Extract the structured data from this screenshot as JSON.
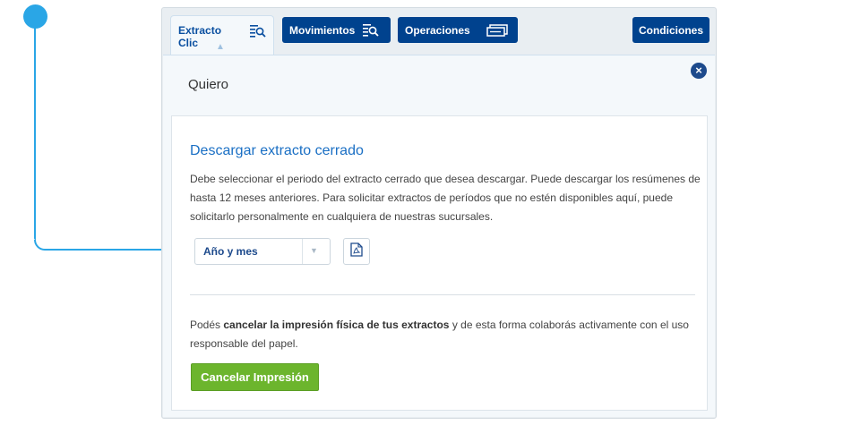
{
  "tabs": {
    "extracto_label": "Extracto Clic",
    "movimientos_label": "Movimientos",
    "operaciones_label": "Operaciones",
    "condiciones_label": "Condiciones",
    "extracto_icon": "list-search-icon",
    "movimientos_icon": "list-search-icon",
    "operaciones_icon": "transfer-icon",
    "active_caret_icon": "chevron-up-icon"
  },
  "panel": {
    "title": "Quiero",
    "close_icon": "close-icon"
  },
  "card": {
    "heading": "Descargar extracto cerrado",
    "description": "Debe seleccionar el periodo del extracto cerrado que desea descargar. Puede descargar los resúmenes de hasta 12 meses anteriores. Para solicitar extractos de períodos que no estén disponibles aquí, puede solicitarlo personalmente en cualquiera de nuestras sucursales.",
    "period_select": {
      "selected": "Año y mes",
      "icon": "chevron-down-icon"
    },
    "pdf_icon": "pdf-document-icon",
    "note_prefix": "Podés ",
    "note_bold": "cancelar la impresión física de tus extractos",
    "note_suffix": " y de esta forma colaborás activamente con el uso responsable del papel.",
    "cancel_button": "Cancelar Impresión"
  },
  "colors": {
    "brand_blue": "#00428e",
    "accent_blue": "#1a6fc4",
    "callout": "#2aa6e6",
    "cta_green": "#6cb52d"
  }
}
